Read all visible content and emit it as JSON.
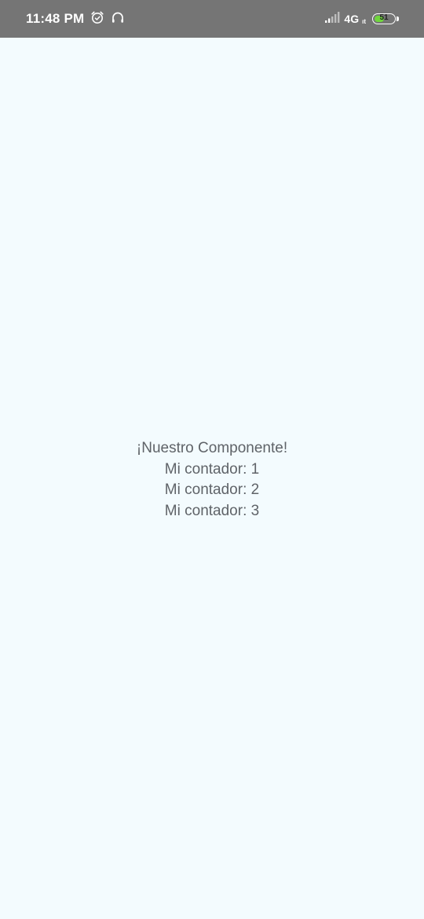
{
  "status_bar": {
    "time": "11:48 PM",
    "left_icons": [
      "alarm-clock-icon",
      "headphones-icon"
    ],
    "signal_icon": "signal-bars-icon",
    "network_type": "4G",
    "network_sub": "ıt",
    "battery_level": "51",
    "battery_fill_percent": 51,
    "battery_color": "#6fd63c",
    "background_color": "#757575"
  },
  "main": {
    "background_color": "#f3fbfe",
    "title": "¡Nuestro Componente!",
    "counters": [
      "Mi contador: 1",
      "Mi contador: 2",
      "Mi contador: 3"
    ]
  }
}
